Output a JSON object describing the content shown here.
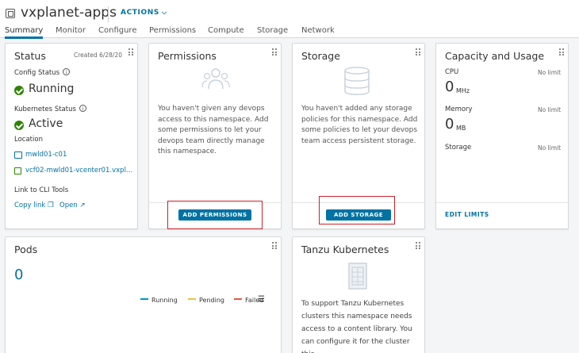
{
  "header": {
    "title": "vxplanet-apps",
    "actions_label": "ACTIONS",
    "tabs": [
      "Summary",
      "Monitor",
      "Configure",
      "Permissions",
      "Compute",
      "Storage",
      "Network"
    ],
    "active_tab": "Summary"
  },
  "status_card": {
    "title": "Status",
    "created": "Created 6/28/20",
    "config_status_label": "Config Status",
    "config_status_value": "Running",
    "k8s_status_label": "Kubernetes Status",
    "k8s_status_value": "Active",
    "location_label": "Location",
    "cluster": "mwld01-c01",
    "vcenter": "vcf02-mwld01-vcenter01.vxpl...",
    "cli_label": "Link to CLI Tools",
    "copy_link": "Copy link",
    "open": "Open"
  },
  "permissions_card": {
    "title": "Permissions",
    "text": "You haven't given any devops access to this namespace. Add some permissions to let your devops team directly manage this namespace.",
    "button": "ADD PERMISSIONS"
  },
  "storage_card": {
    "title": "Storage",
    "text": "You haven't added any storage policies for this namespace. Add some policies to let your devops team access persistent storage.",
    "button": "ADD STORAGE"
  },
  "capacity_card": {
    "title": "Capacity and Usage",
    "cpu_label": "CPU",
    "cpu_limit": "No limit",
    "cpu_value": "0",
    "cpu_unit": "MHz",
    "memory_label": "Memory",
    "memory_limit": "No limit",
    "memory_value": "0",
    "memory_unit": "MB",
    "storage_label": "Storage",
    "storage_limit": "No limit",
    "edit_limits": "EDIT LIMITS"
  },
  "pods_card": {
    "title": "Pods",
    "count": "0",
    "legend": [
      {
        "label": "Running",
        "color": "#0095d3"
      },
      {
        "label": "Pending",
        "color": "#f5c12e"
      },
      {
        "label": "Failed",
        "color": "#e4583e"
      }
    ]
  },
  "tanzu_card": {
    "title": "Tanzu Kubernetes",
    "text": "To support Tanzu Kubernetes clusters this namespace needs access to a content library. You can configure it for the cluster this"
  },
  "colors": {
    "accent": "#0072a3",
    "running": "#2f8400",
    "highlight": "#c8222a"
  }
}
